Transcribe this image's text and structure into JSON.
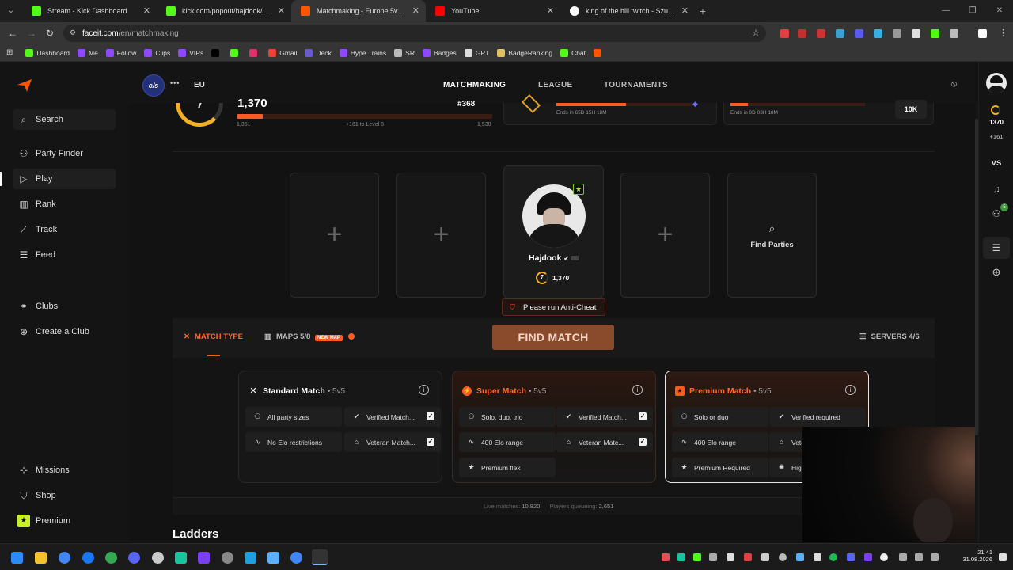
{
  "browser": {
    "tabs": [
      {
        "title": "Stream - Kick Dashboard",
        "fav": "#53fc18",
        "active": false
      },
      {
        "title": "kick.com/popout/hajdook/chat",
        "fav": "#53fc18",
        "active": false
      },
      {
        "title": "Matchmaking - Europe 5v5 Qu",
        "fav": "#ff5500",
        "active": true
      },
      {
        "title": "YouTube",
        "fav": "#ff0000",
        "active": false
      },
      {
        "title": "king of the hill twitch - Szukaj w",
        "fav": "#ffffff",
        "active": false
      }
    ],
    "close_glyph": "✕",
    "newtab_glyph": "+",
    "url_host": "faceit.com",
    "url_path": "/en/matchmaking",
    "bookmarks": [
      {
        "label": "Dashboard",
        "color": "#53fc18"
      },
      {
        "label": "Me",
        "color": "#9146ff"
      },
      {
        "label": "Follow",
        "color": "#9146ff"
      },
      {
        "label": "Clips",
        "color": "#9146ff"
      },
      {
        "label": "VIPs",
        "color": "#9146ff"
      },
      {
        "label": "",
        "color": "#000000"
      },
      {
        "label": "",
        "color": "#53fc18"
      },
      {
        "label": "",
        "color": "#e1306c"
      },
      {
        "label": "Gmail",
        "color": "#ea4335"
      },
      {
        "label": "Deck",
        "color": "#6a5acd"
      },
      {
        "label": "Hype Trains",
        "color": "#9146ff"
      },
      {
        "label": "SR",
        "color": "#bbbbbb"
      },
      {
        "label": "Badges",
        "color": "#9146ff"
      },
      {
        "label": "GPT",
        "color": "#dddddd"
      },
      {
        "label": "BadgeRanking",
        "color": "#e0c060"
      },
      {
        "label": "Chat",
        "color": "#53fc18"
      },
      {
        "label": "",
        "color": "#ff5500"
      }
    ]
  },
  "sidebar": {
    "items": [
      {
        "label": "Search",
        "icon": "search-icon",
        "glyph": "⌕"
      },
      {
        "label": "Party Finder",
        "icon": "party-finder-icon",
        "glyph": "⚇"
      },
      {
        "label": "Play",
        "icon": "play-icon",
        "glyph": "▷"
      },
      {
        "label": "Rank",
        "icon": "rank-icon",
        "glyph": "▥"
      },
      {
        "label": "Track",
        "icon": "track-icon",
        "glyph": "⟋"
      },
      {
        "label": "Feed",
        "icon": "feed-icon",
        "glyph": "☰"
      },
      {
        "label": "Clubs",
        "icon": "clubs-icon",
        "glyph": "⚭"
      },
      {
        "label": "Create a Club",
        "icon": "create-club-icon",
        "glyph": "⊕"
      },
      {
        "label": "Missions",
        "icon": "missions-icon",
        "glyph": "⊹"
      },
      {
        "label": "Shop",
        "icon": "shop-icon",
        "glyph": "⛉"
      },
      {
        "label": "Premium",
        "icon": "premium-icon",
        "glyph": "★"
      }
    ]
  },
  "topnav": {
    "game_badge": "c/s",
    "more_glyph": "•••",
    "region": "EU",
    "links": [
      "MATCHMAKING",
      "LEAGUE",
      "TOURNAMENTS"
    ]
  },
  "stats": {
    "level": "7",
    "elo": "1,370",
    "rank": "#368",
    "min": "1,351",
    "to_next": "+161 to Level 8",
    "max": "1,530",
    "progress": 0.1,
    "challenge1_ends": "Ends in 65D 15H 18M",
    "challenge2_ends": "Ends in 0D 03H 18M",
    "challenge2_value": "10K"
  },
  "party": {
    "player_name": "Hajdook",
    "player_level": "7",
    "player_elo": "1,370",
    "anticheat": "Please run Anti-Cheat",
    "find_parties": "Find Parties",
    "plus_glyph": "+"
  },
  "findbar": {
    "match_type": "MATCH TYPE",
    "maps": "MAPS 5/8",
    "new_map": "NEW MAP",
    "find_match": "FIND MATCH",
    "servers": "SERVERS 4/6"
  },
  "modes": [
    {
      "title": "Standard Match",
      "sub": "• 5v5",
      "glyph": "✕",
      "color": "#ffffff",
      "features": [
        {
          "label": "All party sizes",
          "glyph": "⚇",
          "check": false
        },
        {
          "label": "Verified Match...",
          "glyph": "✔",
          "check": true
        },
        {
          "label": "No Elo restrictions",
          "glyph": "∿",
          "check": false
        },
        {
          "label": "Veteran Match...",
          "glyph": "⌂",
          "check": true
        }
      ]
    },
    {
      "title": "Super Match",
      "sub": "• 5v5",
      "glyph": "⚡",
      "color": "#ff6a2a",
      "features": [
        {
          "label": "Solo, duo, trio",
          "glyph": "⚇",
          "check": false
        },
        {
          "label": "Verified Match...",
          "glyph": "✔",
          "check": true
        },
        {
          "label": "400 Elo range",
          "glyph": "∿",
          "check": false
        },
        {
          "label": "Veteran Matc...",
          "glyph": "⌂",
          "check": true
        },
        {
          "label": "Premium flex",
          "glyph": "★",
          "check": false
        }
      ]
    },
    {
      "title": "Premium Match",
      "sub": "• 5v5",
      "glyph": "★",
      "color": "#ff6a2a",
      "features": [
        {
          "label": "Solo or duo",
          "glyph": "⚇",
          "check": false
        },
        {
          "label": "Verified required",
          "glyph": "✔",
          "check": false
        },
        {
          "label": "400 Elo range",
          "glyph": "∿",
          "check": false
        },
        {
          "label": "Vete",
          "glyph": "⌂",
          "check": false
        },
        {
          "label": "Premium Required",
          "glyph": "★",
          "check": false
        },
        {
          "label": "High",
          "glyph": "✺",
          "check": false
        }
      ]
    }
  ],
  "info_glyph": "i",
  "check_glyph": "✓",
  "live": {
    "live_label": "Live matches:",
    "live_value": "10,820",
    "queue_label": "Players queueing:",
    "queue_value": "2,651"
  },
  "ladders": "Ladders",
  "rightbar": {
    "elo": "1370",
    "delta": "+161",
    "vs": "VS",
    "notif_badge": "5"
  },
  "taskbar": {
    "time": "21:41",
    "date": "31.08.2026"
  }
}
